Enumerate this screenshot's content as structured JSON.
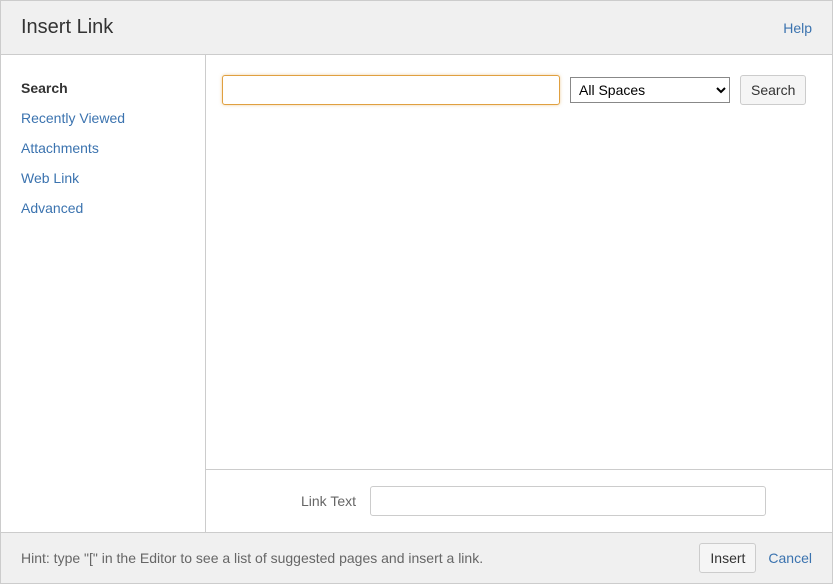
{
  "header": {
    "title": "Insert Link",
    "help_label": "Help"
  },
  "sidebar": {
    "items": [
      {
        "label": "Search",
        "active": true
      },
      {
        "label": "Recently Viewed",
        "active": false
      },
      {
        "label": "Attachments",
        "active": false
      },
      {
        "label": "Web Link",
        "active": false
      },
      {
        "label": "Advanced",
        "active": false
      }
    ]
  },
  "search": {
    "query_value": "",
    "space_selected": "All Spaces",
    "search_button_label": "Search"
  },
  "link_text": {
    "label": "Link Text",
    "value": ""
  },
  "footer": {
    "hint": "Hint: type \"[\" in the Editor to see a list of suggested pages and insert a link.",
    "insert_label": "Insert",
    "cancel_label": "Cancel"
  }
}
